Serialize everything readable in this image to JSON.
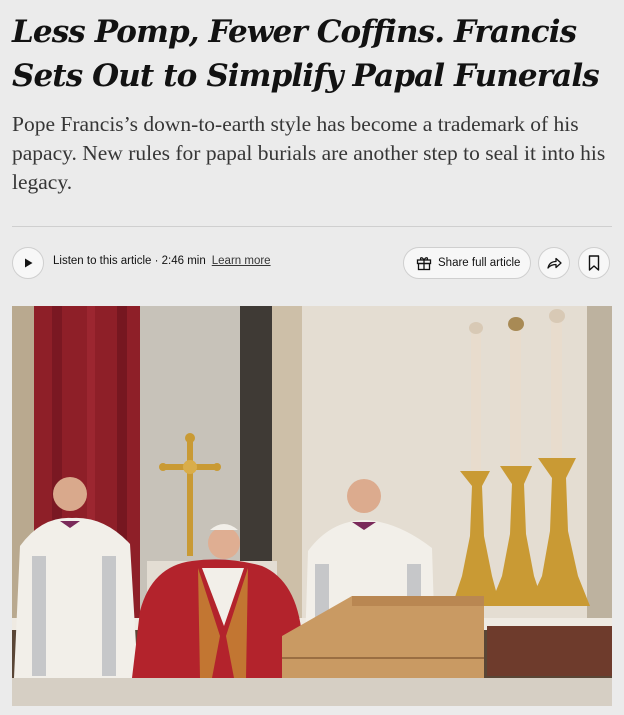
{
  "article": {
    "headline": "Less Pomp, Fewer Coffins. Francis Sets Out to Simplify Papal Funerals",
    "summary": "Pope Francis’s down-to-earth style has become a trademark of his papacy. New rules for papal burials are another step to seal it into his legacy."
  },
  "toolbar": {
    "listen_label": "Listen to this article · 2:46 min",
    "learn_more": "Learn more",
    "share_full_label": "Share full article",
    "icons": {
      "play": "play-icon",
      "gift": "gift-icon",
      "share": "share-arrow-icon",
      "bookmark": "bookmark-icon"
    }
  },
  "photo": {
    "description_icon": "photo-pope-francis-mass",
    "colors": {
      "red_drape": "#8e1f28",
      "vestment_white": "#f2efe9",
      "gold": "#c99a34",
      "coffin_wood": "#c99a63"
    }
  }
}
